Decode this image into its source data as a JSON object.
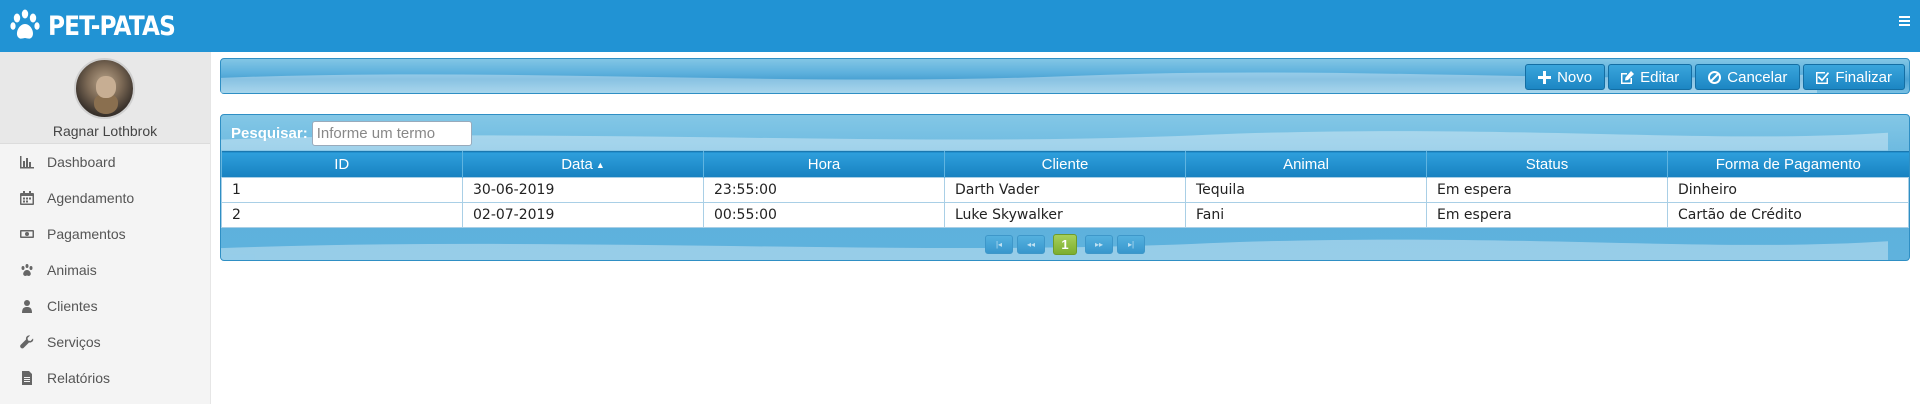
{
  "header": {
    "brand": "PET-PATAS",
    "brand_icon": "paw-icon",
    "menu_icon": "hamburger-icon",
    "color": "#2193d4"
  },
  "sidebar": {
    "user_name": "Ragnar Lothbrok",
    "items": [
      {
        "label": "Dashboard",
        "icon": "bar-chart-icon"
      },
      {
        "label": "Agendamento",
        "icon": "calendar-icon"
      },
      {
        "label": "Pagamentos",
        "icon": "money-icon"
      },
      {
        "label": "Animais",
        "icon": "paw-icon"
      },
      {
        "label": "Clientes",
        "icon": "user-icon"
      },
      {
        "label": "Serviços",
        "icon": "wrench-icon"
      },
      {
        "label": "Relatórios",
        "icon": "file-icon"
      }
    ]
  },
  "toolbar": {
    "buttons": [
      {
        "label": "Novo",
        "icon": "plus-icon"
      },
      {
        "label": "Editar",
        "icon": "edit-icon"
      },
      {
        "label": "Cancelar",
        "icon": "ban-icon"
      },
      {
        "label": "Finalizar",
        "icon": "check-square-icon"
      }
    ]
  },
  "table": {
    "search_label": "Pesquisar:",
    "search_placeholder": "Informe um termo",
    "columns": [
      "ID",
      "Data",
      "Hora",
      "Cliente",
      "Animal",
      "Status",
      "Forma de Pagamento"
    ],
    "sorted_column": "Data",
    "rows": [
      [
        "1",
        "30-06-2019",
        "23:55:00",
        "Darth Vader",
        "Tequila",
        "Em espera",
        "Dinheiro"
      ],
      [
        "2",
        "02-07-2019",
        "00:55:00",
        "Luke Skywalker",
        "Fani",
        "Em espera",
        "Cartão de Crédito"
      ]
    ],
    "pagination": {
      "current_page": "1",
      "first": "|◂",
      "prev": "◂◂",
      "next": "▸▸",
      "last": "▸|"
    }
  }
}
